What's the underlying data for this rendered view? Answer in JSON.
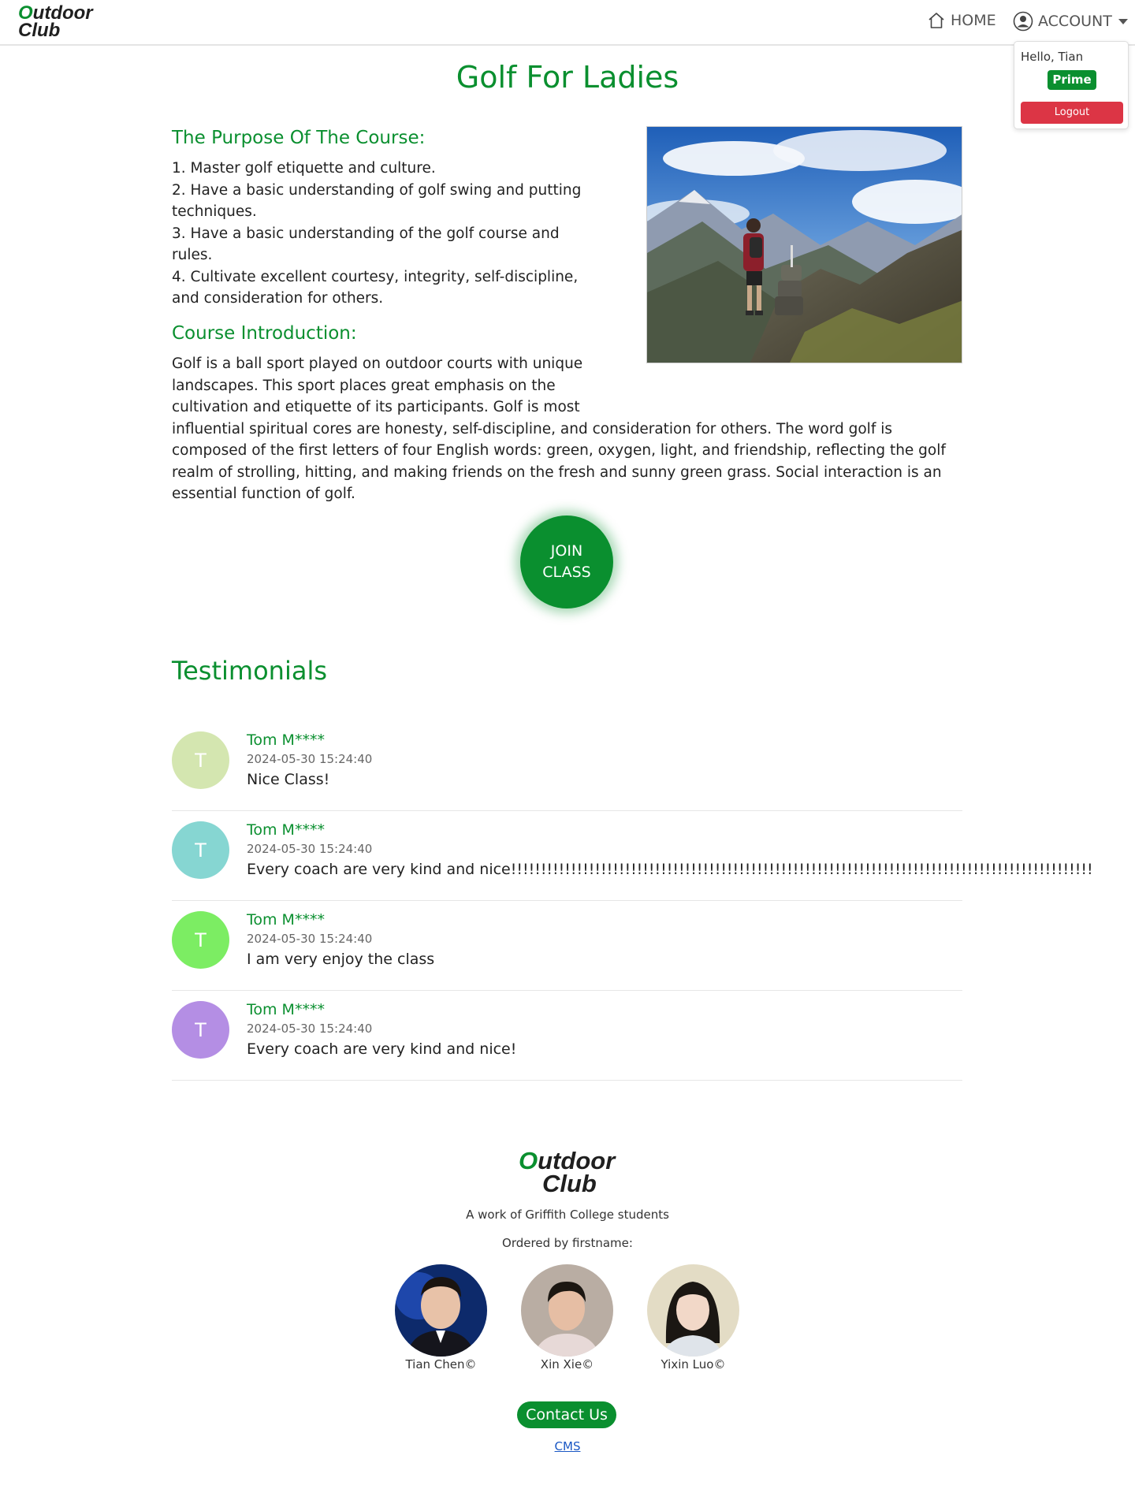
{
  "brand": {
    "logo_o": "O",
    "logo_line1_rest": "utdoor",
    "logo_line2": "Club"
  },
  "nav": {
    "home_label": "HOME",
    "account_label": "ACCOUNT"
  },
  "account_menu": {
    "greeting": "Hello, Tian",
    "badge": "Prime",
    "logout_label": "Logout"
  },
  "page": {
    "title": "Golf For Ladies"
  },
  "purpose": {
    "heading": "The Purpose Of The Course:",
    "items": [
      "1. Master golf etiquette and culture.",
      "2. Have a basic understanding of golf swing and putting techniques.",
      "3. Have a basic understanding of the golf course and rules.",
      "4. Cultivate excellent courtesy, integrity, self-discipline, and consideration for others."
    ]
  },
  "introduction": {
    "heading": "Course Introduction:",
    "text": "Golf is a ball sport played on outdoor courts with unique landscapes. This sport places great emphasis on the cultivation and etiquette of its participants. Golf is most influential spiritual cores are honesty, self-discipline, and consideration for others. The word golf is composed of the first letters of four English words: green, oxygen, light, and friendship, reflecting the golf realm of strolling, hitting, and making friends on the fresh and sunny green grass. Social interaction is an essential function of golf."
  },
  "join_button": {
    "label_line1": "JOIN",
    "label_line2": "CLASS"
  },
  "testimonials": {
    "title": "Testimonials",
    "items": [
      {
        "initial": "T",
        "name": "Tom M****",
        "date": "2024-05-30 15:24:40",
        "text": "Nice Class!",
        "color": "#d4e6b0"
      },
      {
        "initial": "T",
        "name": "Tom M****",
        "date": "2024-05-30 15:24:40",
        "text": "Every coach are very kind and nice!!!!!!!!!!!!!!!!!!!!!!!!!!!!!!!!!!!!!!!!!!!!!!!!!!!!!!!!!!!!!!!!!!!!!!!!!!!!!!!!!!!!!!!!!!!!!!!!!",
        "color": "#86d6d2"
      },
      {
        "initial": "T",
        "name": "Tom M****",
        "date": "2024-05-30 15:24:40",
        "text": "I am very enjoy the class",
        "color": "#7ced63"
      },
      {
        "initial": "T",
        "name": "Tom M****",
        "date": "2024-05-30 15:24:40",
        "text": "Every coach are very kind and nice!",
        "color": "#b48ee4"
      }
    ]
  },
  "footer": {
    "tagline": "A work of Griffith College students",
    "ordered_by": "Ordered by firstname:",
    "members": [
      {
        "name": "Tian Chen©"
      },
      {
        "name": "Xin Xie©"
      },
      {
        "name": "Yixin Luo©"
      }
    ],
    "contact_label": "Contact Us",
    "cms_label": "CMS"
  },
  "colors": {
    "brand_green": "#0a8f2f",
    "logout_red": "#dc3545",
    "link_blue": "#1a57c4"
  }
}
